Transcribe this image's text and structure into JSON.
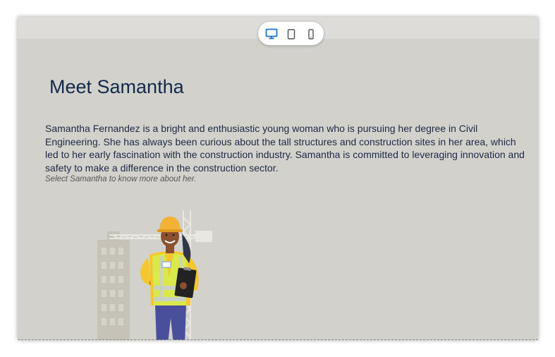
{
  "device_switcher": {
    "options": [
      {
        "name": "desktop",
        "icon": "monitor-icon",
        "active": true
      },
      {
        "name": "tablet",
        "icon": "tablet-icon",
        "active": false
      },
      {
        "name": "mobile",
        "icon": "phone-icon",
        "active": false
      }
    ],
    "active_color": "#1f6fd1",
    "inactive_color": "#555555"
  },
  "page": {
    "title": "Meet Samantha",
    "description": "Samantha Fernandez is a bright and enthusiastic young woman who is pursuing her degree in Civil Engineering. She has always been curious about the tall structures and construction sites in her area, which led to her early fascination with the construction industry. Samantha is committed to leveraging innovation and safety to make a difference in the construction sector.",
    "hint": "Select Samantha to know more about her."
  },
  "colors": {
    "background": "#d3d1cc",
    "title": "#13294b",
    "vest": "#d9e84a",
    "hardhat": "#f2b233",
    "shirt": "#f6c62f",
    "pants": "#4a4f9c"
  }
}
